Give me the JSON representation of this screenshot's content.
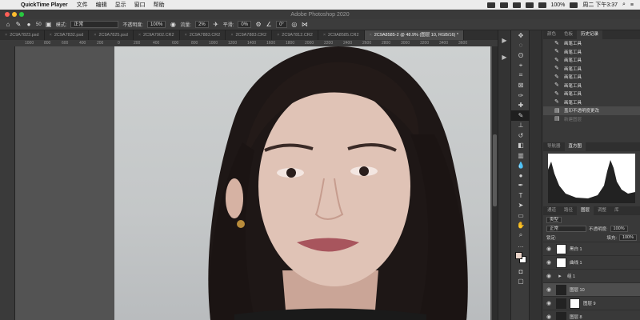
{
  "menubar": {
    "app_name": "QuickTime Player",
    "items": [
      "文件",
      "编辑",
      "显示",
      "窗口",
      "帮助"
    ],
    "battery": "100%",
    "clock": "周二 下午3:37"
  },
  "window": {
    "title": "Adobe Photoshop 2020"
  },
  "options": {
    "brush_size": "50",
    "mode_label": "模式:",
    "mode_value": "正常",
    "opacity_label": "不透明度:",
    "opacity_value": "100%",
    "flow_label": "流量:",
    "flow_value": "2%",
    "smooth_label": "平滑:",
    "smooth_value": "0%",
    "angle_value": "0°"
  },
  "tabs": [
    {
      "label": "2C9A7823.psd"
    },
    {
      "label": "2C9A7832.psd"
    },
    {
      "label": "2C9A7825.psd"
    },
    {
      "label": "2C9A7902.CR2"
    },
    {
      "label": "2C9A7883.CR2"
    },
    {
      "label": "2C9A7883.CR2"
    },
    {
      "label": "2C9A7812.CR2"
    },
    {
      "label": "2C9A8585.CR2"
    },
    {
      "label": "2C9A8585-2 @ 48.9% (图层 10, RGB/16) *"
    }
  ],
  "ruler": [
    "1000",
    "800",
    "600",
    "400",
    "200",
    "0",
    "200",
    "400",
    "600",
    "800",
    "1000",
    "1200",
    "1400",
    "1600",
    "1800",
    "2000",
    "2200",
    "2400",
    "2600",
    "2800",
    "3000",
    "3200",
    "3400",
    "3600"
  ],
  "history_panel": {
    "tabs": [
      "颜色",
      "色板",
      "历史记录"
    ],
    "rows": [
      {
        "label": "画笔工具"
      },
      {
        "label": "画笔工具"
      },
      {
        "label": "画笔工具"
      },
      {
        "label": "画笔工具"
      },
      {
        "label": "画笔工具"
      },
      {
        "label": "画笔工具"
      },
      {
        "label": "画笔工具"
      },
      {
        "label": "画笔工具"
      },
      {
        "label": "盖印不透明度更改"
      },
      {
        "label": "新建图层"
      }
    ]
  },
  "histogram_panel": {
    "tabs": [
      "导航器",
      "直方图"
    ]
  },
  "layers_panel": {
    "tabs": [
      "通道",
      "路径",
      "图层",
      "调整",
      "库"
    ],
    "kind_label": "类型",
    "blend_mode": "正常",
    "opacity_label": "不透明度:",
    "opacity_value": "100%",
    "lock_label": "锁定:",
    "fill_label": "填充:",
    "fill_value": "100%",
    "layers": [
      {
        "name": "黑白 1"
      },
      {
        "name": "曲线 1"
      },
      {
        "name": "组 1"
      },
      {
        "name": "图层 10"
      },
      {
        "name": "图层 9"
      },
      {
        "name": "图层 8"
      }
    ]
  },
  "colors": {
    "foreground": "#e9d3c8",
    "background": "#ffffff"
  }
}
